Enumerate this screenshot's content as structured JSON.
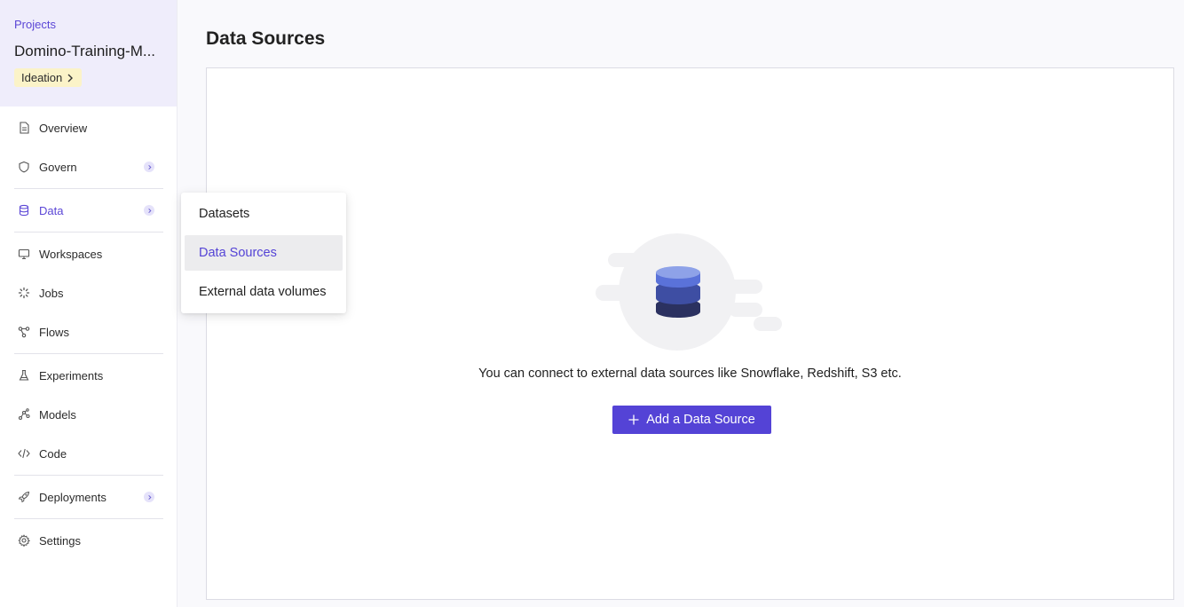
{
  "project": {
    "breadcrumb": "Projects",
    "name": "Domino-Training-M...",
    "stage": "Ideation"
  },
  "sidebar": {
    "items": [
      {
        "label": "Overview",
        "icon": "document-icon"
      },
      {
        "label": "Govern",
        "icon": "shield-icon"
      },
      {
        "label": "Data",
        "icon": "database-icon",
        "active": true
      },
      {
        "label": "Workspaces",
        "icon": "monitor-icon"
      },
      {
        "label": "Jobs",
        "icon": "spinner-icon"
      },
      {
        "label": "Flows",
        "icon": "flow-icon"
      },
      {
        "label": "Experiments",
        "icon": "flask-icon"
      },
      {
        "label": "Models",
        "icon": "model-icon"
      },
      {
        "label": "Code",
        "icon": "code-icon"
      },
      {
        "label": "Deployments",
        "icon": "rocket-icon"
      },
      {
        "label": "Settings",
        "icon": "gear-icon"
      }
    ]
  },
  "data_menu": {
    "items": [
      "Datasets",
      "Data Sources",
      "External data volumes"
    ],
    "selected": "Data Sources"
  },
  "main": {
    "title": "Data Sources",
    "empty_message": "You can connect to external data sources like Snowflake, Redshift, S3 etc.",
    "add_button": "Add a Data Source"
  },
  "colors": {
    "accent": "#5443d6",
    "header_bg": "#efedfb",
    "stage_badge_bg": "#fbf3c8"
  }
}
